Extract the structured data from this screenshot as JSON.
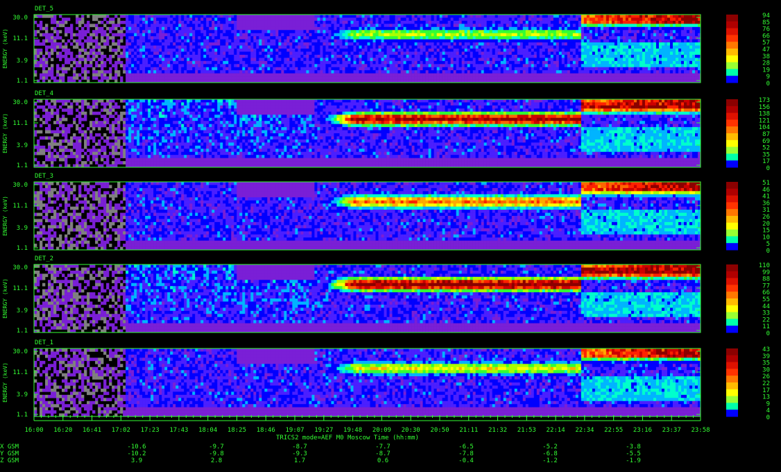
{
  "chart_data": {
    "type": "heatmap",
    "ylabel": "ENERGY (keV)",
    "y_ticks": [
      "30.0",
      "11.1",
      "3.9",
      "1.1"
    ],
    "panels": [
      {
        "name": "DET_5",
        "colorbar": [
          "94",
          "85",
          "76",
          "66",
          "57",
          "47",
          "38",
          "28",
          "19",
          "9",
          "0"
        ]
      },
      {
        "name": "DET_4",
        "colorbar": [
          "173",
          "156",
          "138",
          "121",
          "104",
          "87",
          "69",
          "52",
          "35",
          "17",
          "0"
        ]
      },
      {
        "name": "DET_3",
        "colorbar": [
          "51",
          "46",
          "41",
          "36",
          "31",
          "26",
          "20",
          "15",
          "10",
          "5",
          "0"
        ]
      },
      {
        "name": "DET_2",
        "colorbar": [
          "110",
          "99",
          "88",
          "77",
          "66",
          "55",
          "44",
          "33",
          "22",
          "11",
          "0"
        ]
      },
      {
        "name": "DET_1",
        "colorbar": [
          "43",
          "39",
          "35",
          "30",
          "26",
          "22",
          "17",
          "13",
          "9",
          "4",
          "0"
        ]
      }
    ],
    "x_ticks": [
      "16:00",
      "16:20",
      "16:41",
      "17:02",
      "17:23",
      "17:43",
      "18:04",
      "18:25",
      "18:46",
      "19:07",
      "19:27",
      "19:48",
      "20:09",
      "20:30",
      "20:50",
      "21:11",
      "21:32",
      "21:53",
      "22:14",
      "22:34",
      "22:55",
      "23:16",
      "23:37",
      "23:58"
    ],
    "xlabel": "TRICS2  mode=AEF  M0    Moscow Time (hh:mm)",
    "ephemeris": [
      {
        "label": "X GSM",
        "values": [
          "-10.6",
          "-9.7",
          "-8.7",
          "-7.7",
          "-6.5",
          "-5.2",
          "-3.8"
        ]
      },
      {
        "label": "Y GSM",
        "values": [
          "-10.2",
          "-9.8",
          "-9.3",
          "-8.7",
          "-7.8",
          "-6.8",
          "-5.5"
        ]
      },
      {
        "label": "Z GSM",
        "values": [
          "3.9",
          "2.8",
          "1.7",
          "0.6",
          "-0.4",
          "-1.2",
          "-1.9"
        ]
      }
    ],
    "colors": {
      "axis": "#33ff33",
      "text": "#33ff33",
      "scale": [
        "#0000ff",
        "#00b4ff",
        "#00ffcc",
        "#33ff33",
        "#aaff00",
        "#ffff00",
        "#ffaa00",
        "#ff6600",
        "#ff2200",
        "#cc0000",
        "#8b0000"
      ]
    }
  }
}
